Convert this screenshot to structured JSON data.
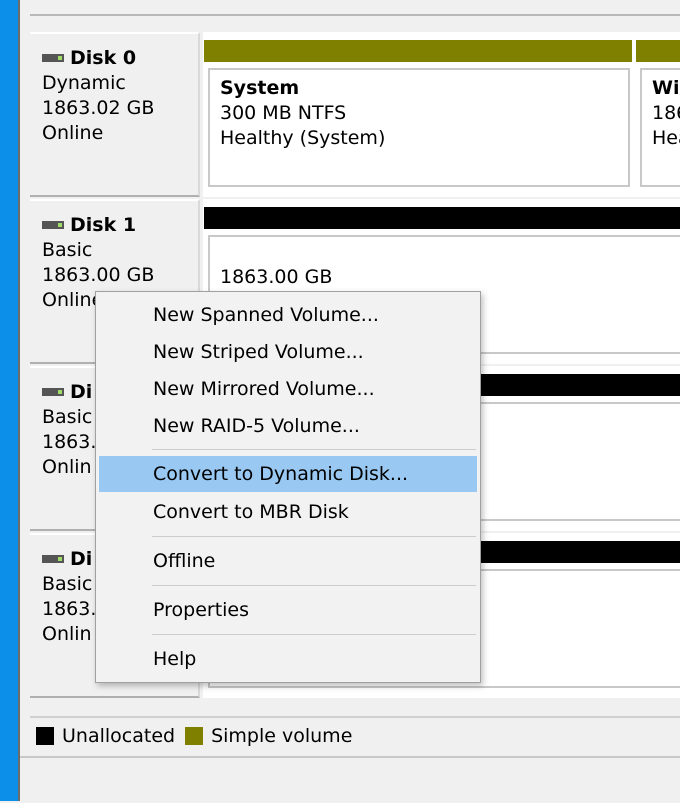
{
  "disks": [
    {
      "name": "Disk 0",
      "type": "Dynamic",
      "size": "1863.02 GB",
      "status": "Online"
    },
    {
      "name": "Disk 1",
      "type": "Basic",
      "size": "1863.00 GB",
      "status": "Online"
    },
    {
      "name": "Di",
      "type": "Basic",
      "size": "1863.0",
      "status": "Onlin"
    },
    {
      "name": "Di",
      "type": "Basic",
      "size": "1863.0",
      "status": "Onlin"
    }
  ],
  "volumes": {
    "system": {
      "name": "System",
      "size": "300 MB NTFS",
      "health": "Healthy (System)"
    },
    "windows": {
      "name": "Win",
      "size": "186",
      "health": "Hea"
    },
    "disk1_unallocated": {
      "size": "1863.00 GB"
    }
  },
  "context_menu": {
    "items": [
      "New Spanned Volume...",
      "New Striped Volume...",
      "New Mirrored Volume...",
      "New RAID-5 Volume...",
      "Convert to Dynamic Disk...",
      "Convert to MBR Disk",
      "Offline",
      "Properties",
      "Help"
    ],
    "highlighted": "Convert to Dynamic Disk..."
  },
  "legend": {
    "unallocated": "Unallocated",
    "simple_volume": "Simple volume"
  },
  "colors": {
    "unallocated": "#000000",
    "simple_volume": "#7f7f00",
    "highlight": "#99c9f2",
    "window_edge": "#0c8fe8"
  }
}
